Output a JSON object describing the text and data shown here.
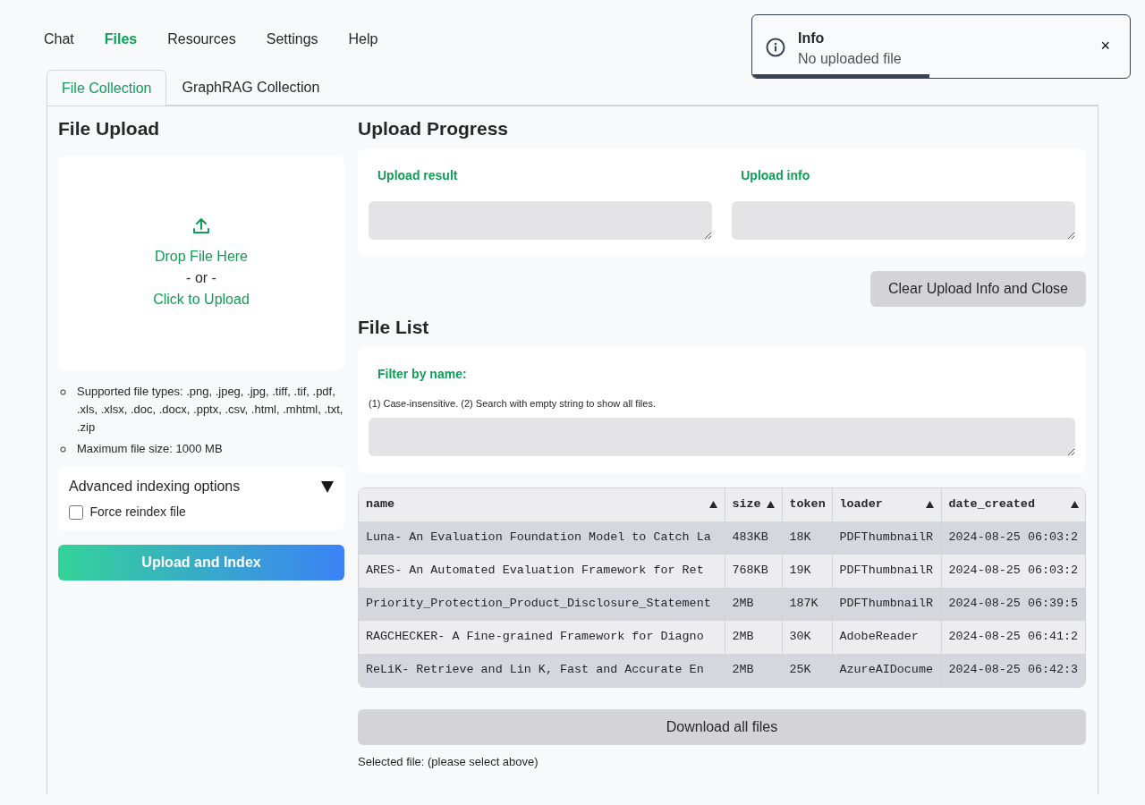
{
  "nav": [
    {
      "label": "Chat",
      "selected": false
    },
    {
      "label": "Files",
      "selected": true
    },
    {
      "label": "Resources",
      "selected": false
    },
    {
      "label": "Settings",
      "selected": false
    },
    {
      "label": "Help",
      "selected": false
    }
  ],
  "toast": {
    "title": "Info",
    "message": "No uploaded file",
    "close": "×",
    "level": 0.47
  },
  "tabs": [
    {
      "label": "File Collection",
      "selected": true
    },
    {
      "label": "GraphRAG Collection",
      "selected": false
    }
  ],
  "upload": {
    "title": "File Upload",
    "drop_text": "Drop File Here",
    "or_text": "- or -",
    "click_text": "Click to Upload",
    "notes": [
      "Supported file types: .png, .jpeg, .jpg, .tiff, .tif, .pdf, .xls, .xlsx, .doc, .docx, .pptx, .csv, .html, .mhtml, .txt, .zip",
      "Maximum file size: 1000 MB"
    ],
    "advanced": {
      "label": "Advanced indexing options",
      "expanded": true,
      "options": [
        {
          "label": "Force reindex file",
          "checked": false
        }
      ]
    },
    "button": "Upload and Index"
  },
  "progress": {
    "title": "Upload Progress",
    "fields": [
      {
        "label": "Upload result"
      },
      {
        "label": "Upload info"
      }
    ],
    "button": "Clear Upload Info and Close"
  },
  "file_list": {
    "title": "File List",
    "filter_label": "Filter by name:",
    "filter_hint": "(1) Case-insensitive. (2) Search with empty string to show all files.",
    "table": {
      "columns": [
        "name",
        "size",
        "token",
        "loader",
        "date_created"
      ],
      "rows": [
        [
          "Luna- An Evaluation Foundation Model to Catch La",
          "483KB",
          "18K",
          "PDFThumbnailR",
          "2024-08-25 06:03:2"
        ],
        [
          "ARES- An Automated Evaluation Framework for Ret",
          "768KB",
          "19K",
          "PDFThumbnailR",
          "2024-08-25 06:03:2"
        ],
        [
          "Priority_Protection_Product_Disclosure_Statement",
          "2MB",
          "187K",
          "PDFThumbnailR",
          "2024-08-25 06:39:5"
        ],
        [
          "RAGCHECKER- A Fine-grained Framework for Diagno",
          "2MB",
          "30K",
          "AdobeReader",
          "2024-08-25 06:41:2"
        ],
        [
          "ReLiK- Retrieve and Lin K, Fast and Accurate En",
          "2MB",
          "25K",
          "AzureAIDocume",
          "2024-08-25 06:42:3"
        ]
      ]
    },
    "download_button": "Download all files",
    "selected_text": "Selected file: (please select above)"
  }
}
